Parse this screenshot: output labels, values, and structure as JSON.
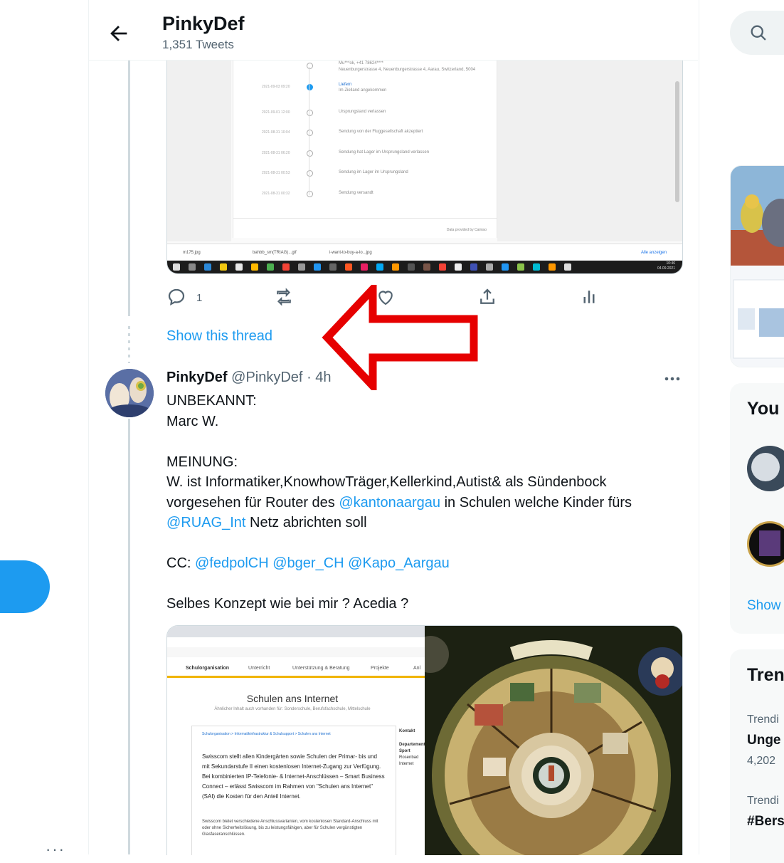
{
  "header": {
    "profile_name": "PinkyDef",
    "tweet_count": "1,351 Tweets"
  },
  "first_tweet": {
    "reply_count": "1",
    "show_thread": "Show this thread"
  },
  "screenshot_content": {
    "tracking_entries": [
      {
        "date": "",
        "text": "Mu***ok, +41 78624****"
      },
      {
        "date": "",
        "text": "Neuenburgerstrasse 4, Neuenburgerstrasse 4, Aarau, Switzerland, 5004"
      },
      {
        "date": "2021-09-03 09:20",
        "text": "Liefern"
      },
      {
        "date": "",
        "text": "Im Zielland angekommen"
      },
      {
        "date": "2021-09-01 12:00",
        "text": "Ursprungsland verlassen"
      },
      {
        "date": "2021-08-31 10:04",
        "text": "Sendung von der Fluggesellschaft akzeptiert"
      },
      {
        "date": "2021-08-31 06:20",
        "text": "Sendung hat Lager im Ursprungsland verlassen"
      },
      {
        "date": "2021-08-31 00:53",
        "text": "Sendung im Lager im Ursprungsland"
      },
      {
        "date": "2021-08-31 00:32",
        "text": "Sendung versandt"
      }
    ],
    "provider": "Data provided by Cainiao",
    "downloads": [
      "m175.jpg",
      "bahbb_sm(TRIAG)...gif",
      "i-want-to-buy-a-lo...jpg"
    ],
    "show_all": "Alle anzeigen",
    "clock_time": "10:46",
    "clock_date": "04.09.2021",
    "page_title": "Schulen ans Internet",
    "page_subtitle": "Ähnlicher Inhalt auch vorhanden für: Sonderschule, Berufsfachschule, Mittelschule",
    "page_nav": [
      "Schulorganisation",
      "Unterricht",
      "Unterstützung & Beratung",
      "Projekte",
      "Anl"
    ],
    "page_breadcrumb": "Schulorganisation > Informatikinfrastruktur & Schulsupport > Schulen ans Internet",
    "page_body": "Swisscom stellt allen Kindergärten sowie Schulen der Primar- bis und mit Sekundarstufe II einen kostenlosen Internet-Zugang zur Verfügung. Bei kombinierten IP-Telefonie- & Internet-Anschlüssen – Smart Business Connect – erlässt Swisscom im Rahmen von \"Schulen ans Internet\" (SAI) die Kosten für den Anteil Internet.",
    "page_body2": "Swisscom bietet verschiedene Anschlussvarianten, vom kostenlosen Standard-Anschluss mit oder ohne Sicherheitslösung, bis zu leistungsfähigen, aber für Schulen vergünstigten Glasfaseranschlüssen.",
    "kontakt": [
      "Kontakt",
      "Departement",
      "Sport",
      "Rosenbad",
      "Internet"
    ]
  },
  "second_tweet": {
    "author_name": "PinkyDef",
    "author_handle": "@PinkyDef",
    "separator": "·",
    "time": "4h",
    "text": {
      "line1": "UNBEKANNT:",
      "line2": "Marc W.",
      "line3": "MEINUNG:",
      "line4": "W. ist Informatiker,KnowhowTräger,Kellerkind,Autist& als Sündenbock",
      "line5_pre": "vorgesehen für Router des ",
      "mention_kanton": "@kantonaargau",
      "line5_post": " in Schulen welche Kinder fürs",
      "mention_ruag": "@RUAG_Int",
      "line6_post": " Netz abrichten soll",
      "cc_label": "CC: ",
      "mention_fedpol": "@fedpolCH",
      "mention_bger": "@bger_CH",
      "mention_kapo": "@Kapo_Aargau",
      "line_last": "Selbes Konzept wie bei mir ? Acedia ?"
    }
  },
  "sidebar": {
    "card_you_title": "You",
    "show_more": "Show",
    "trends_title": "Tren",
    "trend1_label": "Trendi",
    "trend1_name": "Unge",
    "trend1_count": "4,202",
    "trend2_label": "Trendi",
    "trend2_name": "#Bers"
  },
  "colors": {
    "accent": "#1d9bf0",
    "text": "#0f1419",
    "muted": "#536471",
    "annotation_arrow": "#e60000"
  }
}
